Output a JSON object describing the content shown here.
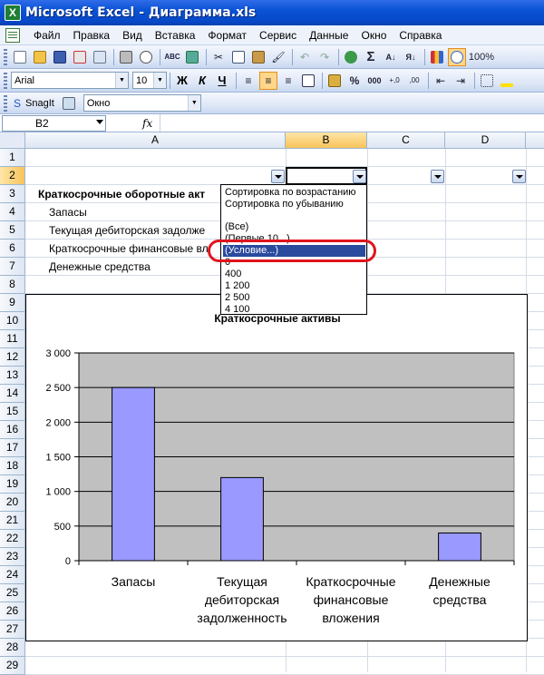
{
  "window": {
    "title": "Microsoft Excel - Диаграмма.xls",
    "app_icon_letter": "X"
  },
  "menu": [
    {
      "label": "Файл"
    },
    {
      "label": "Правка"
    },
    {
      "label": "Вид"
    },
    {
      "label": "Вставка"
    },
    {
      "label": "Формат"
    },
    {
      "label": "Сервис"
    },
    {
      "label": "Данные"
    },
    {
      "label": "Окно"
    },
    {
      "label": "Справка"
    }
  ],
  "standard_toolbar": {
    "zoom": "100%"
  },
  "formatting_toolbar": {
    "font": "Arial",
    "size": "10",
    "bold": "Ж",
    "italic": "К",
    "underline": "Ч",
    "percent": "%",
    "thousands": "000"
  },
  "snagit_toolbar": {
    "label": "SnagIt",
    "combo": "Окно"
  },
  "formula_bar": {
    "name_box": "B2",
    "fx": "fx",
    "value": ""
  },
  "columns": [
    "A",
    "B",
    "C",
    "D"
  ],
  "rows": [
    "1",
    "2",
    "3",
    "4",
    "5",
    "6",
    "7",
    "8",
    "9",
    "10",
    "11",
    "12",
    "13",
    "14",
    "15",
    "16",
    "17",
    "18",
    "19",
    "20",
    "21",
    "22",
    "23",
    "24",
    "25",
    "26",
    "27",
    "28",
    "29"
  ],
  "cells": {
    "a3": "Краткосрочные оборотные акт",
    "a4": "Запасы",
    "a5": "Текущая дебиторская задолже",
    "a6": "Краткосрочные финансовые вл",
    "a7": "Денежные средства"
  },
  "autofilter_dropdown": {
    "items": [
      "Сортировка по возрастанию",
      "Сортировка по убыванию",
      "(Все)",
      "(Первые 10...)",
      "(Условие...)",
      "0",
      "400",
      "1 200",
      "2 500",
      "4 100"
    ],
    "selected_index": 4
  },
  "chart_data": {
    "type": "bar",
    "title": "Краткосрочные активы",
    "categories": [
      "Запасы",
      "Текущая дебиторская задолженность",
      "Краткосрочные финансовые вложения",
      "Денежные средства"
    ],
    "category_lines": [
      [
        "Запасы"
      ],
      [
        "Текущая",
        "дебиторская",
        "задолженность"
      ],
      [
        "Краткосрочные",
        "финансовые",
        "вложения"
      ],
      [
        "Денежные",
        "средства"
      ]
    ],
    "values": [
      2500,
      1200,
      0,
      400
    ],
    "ylim": [
      0,
      3000
    ],
    "yticks": [
      0,
      500,
      1000,
      1500,
      2000,
      2500,
      3000
    ],
    "ytick_labels": [
      "0",
      "500",
      "1 000",
      "1 500",
      "2 000",
      "2 500",
      "3 000"
    ],
    "grid": true,
    "colors": {
      "bar": "#9999ff",
      "plot_bg": "#c0c0c0"
    }
  }
}
